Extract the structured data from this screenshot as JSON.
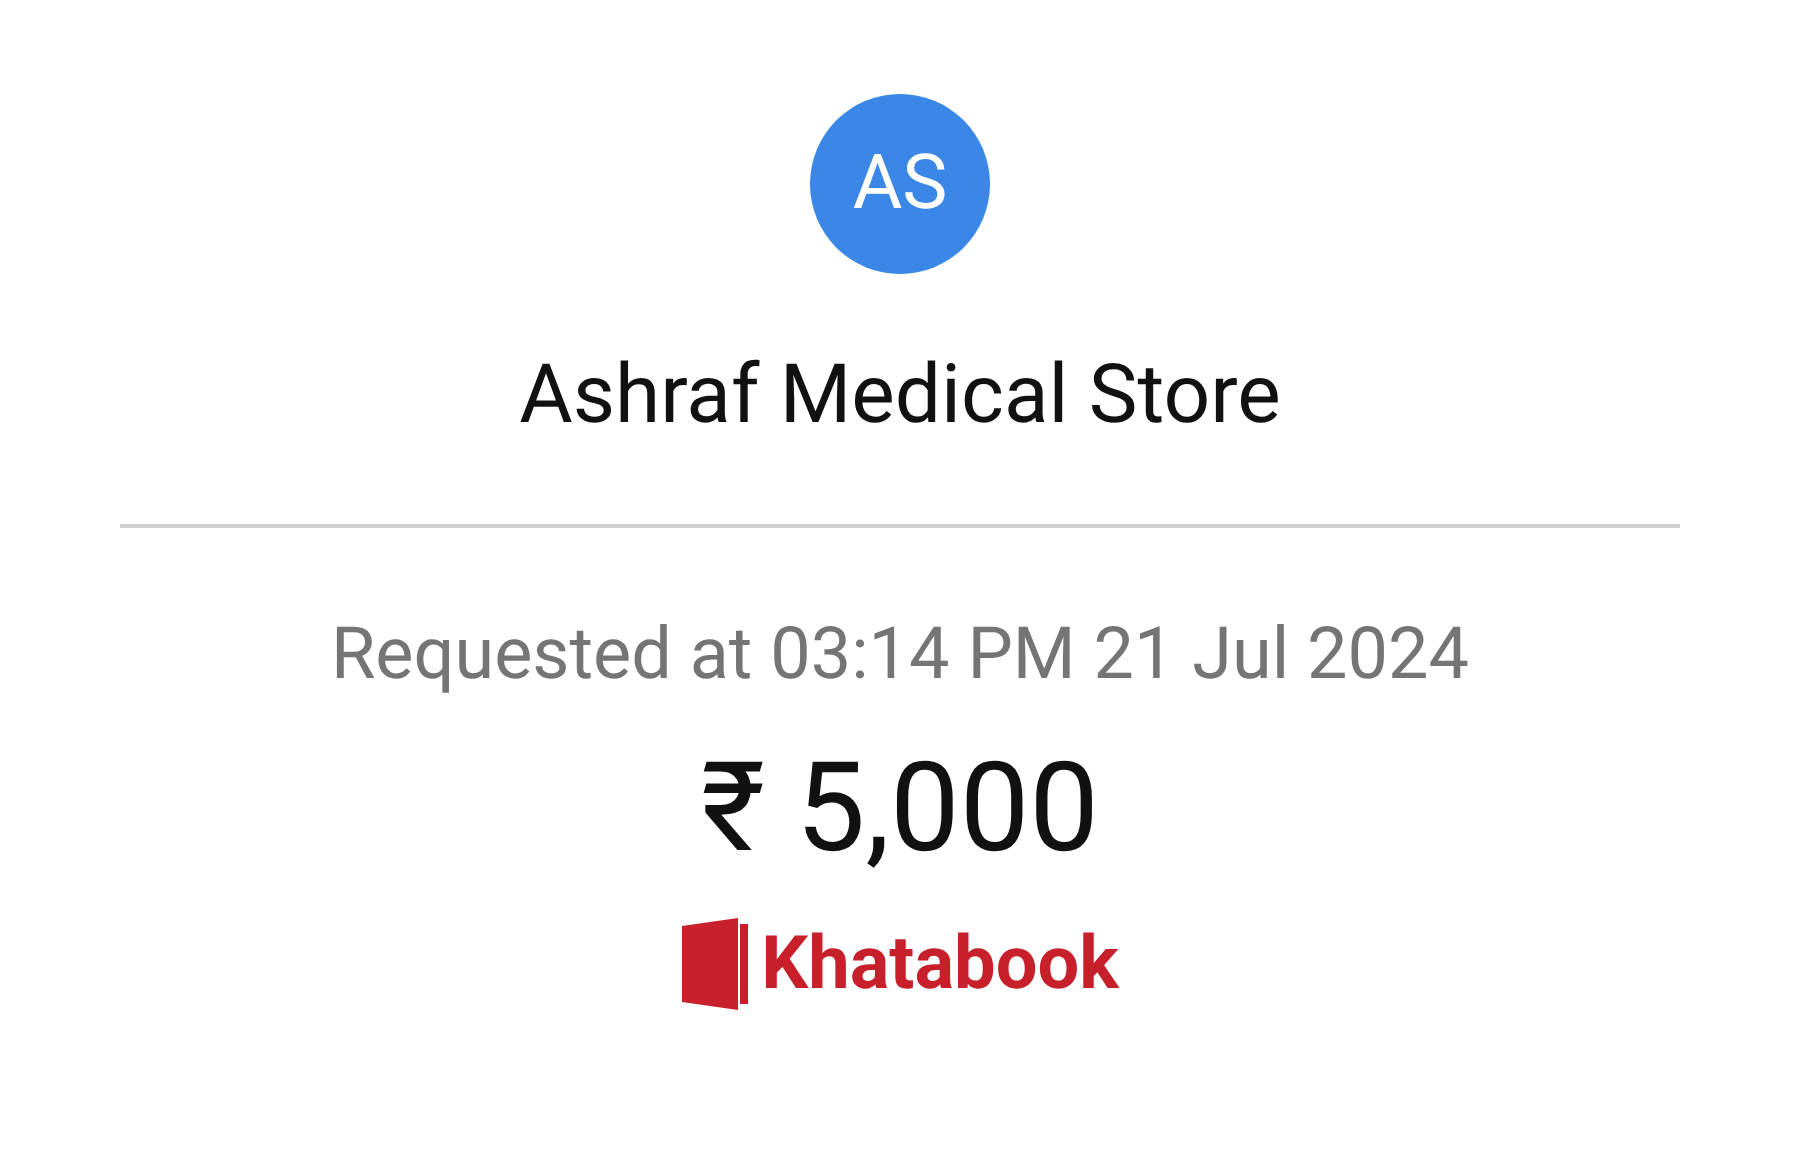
{
  "avatar": {
    "initials": "AS"
  },
  "store_name": "Ashraf Medical Store",
  "requested_at": "Requested at 03:14 PM 21 Jul 2024",
  "amount": "₹ 5,000",
  "brand": {
    "name": "Khatabook"
  }
}
